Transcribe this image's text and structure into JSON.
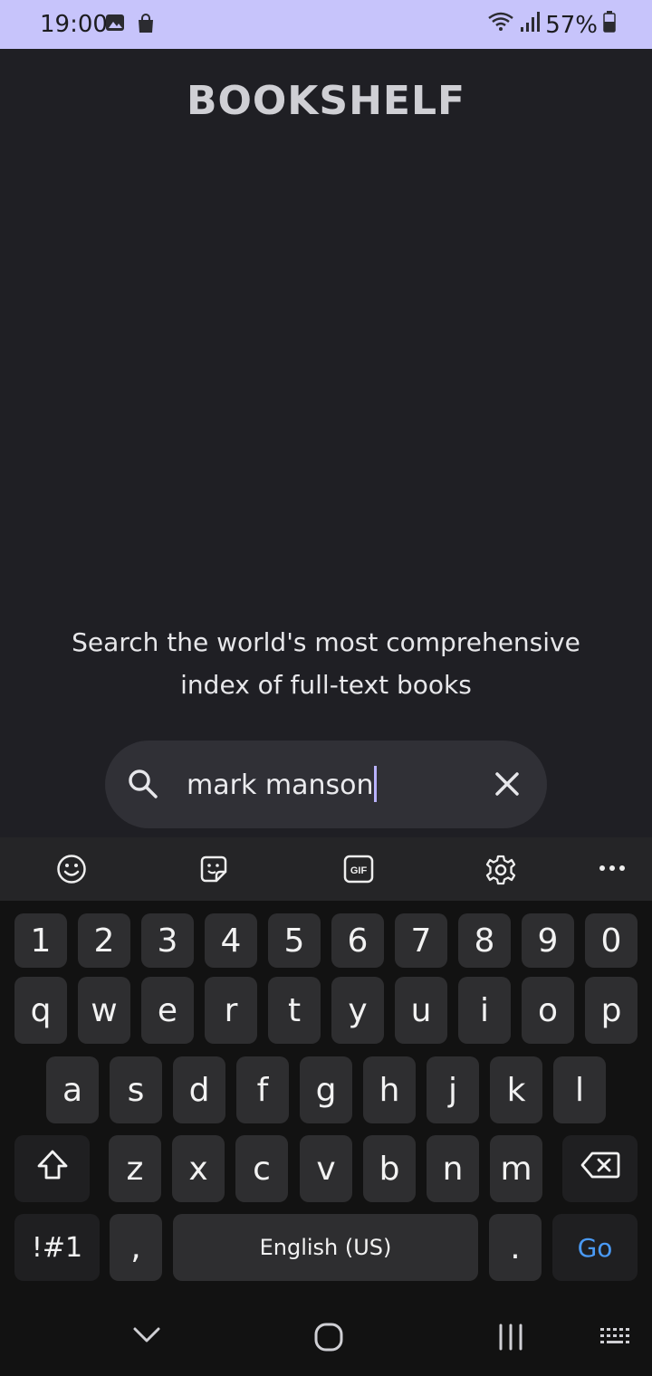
{
  "status_bar": {
    "time": "19:00",
    "battery": "57%"
  },
  "app": {
    "title": "BOOKSHELF",
    "tagline_line1": "Search the world's most comprehensive",
    "tagline_line2": "index of full-text books",
    "search": {
      "value": "mark manson"
    }
  },
  "keyboard": {
    "number_row": [
      "1",
      "2",
      "3",
      "4",
      "5",
      "6",
      "7",
      "8",
      "9",
      "0"
    ],
    "row1": [
      "q",
      "w",
      "e",
      "r",
      "t",
      "y",
      "u",
      "i",
      "o",
      "p"
    ],
    "row2": [
      "a",
      "s",
      "d",
      "f",
      "g",
      "h",
      "j",
      "k",
      "l"
    ],
    "row3": [
      "z",
      "x",
      "c",
      "v",
      "b",
      "n",
      "m"
    ],
    "symbols_label": "!#1",
    "comma_label": ",",
    "space_label": "English (US)",
    "period_label": ".",
    "go_label": "Go",
    "accent_color": "#4a9af5"
  }
}
